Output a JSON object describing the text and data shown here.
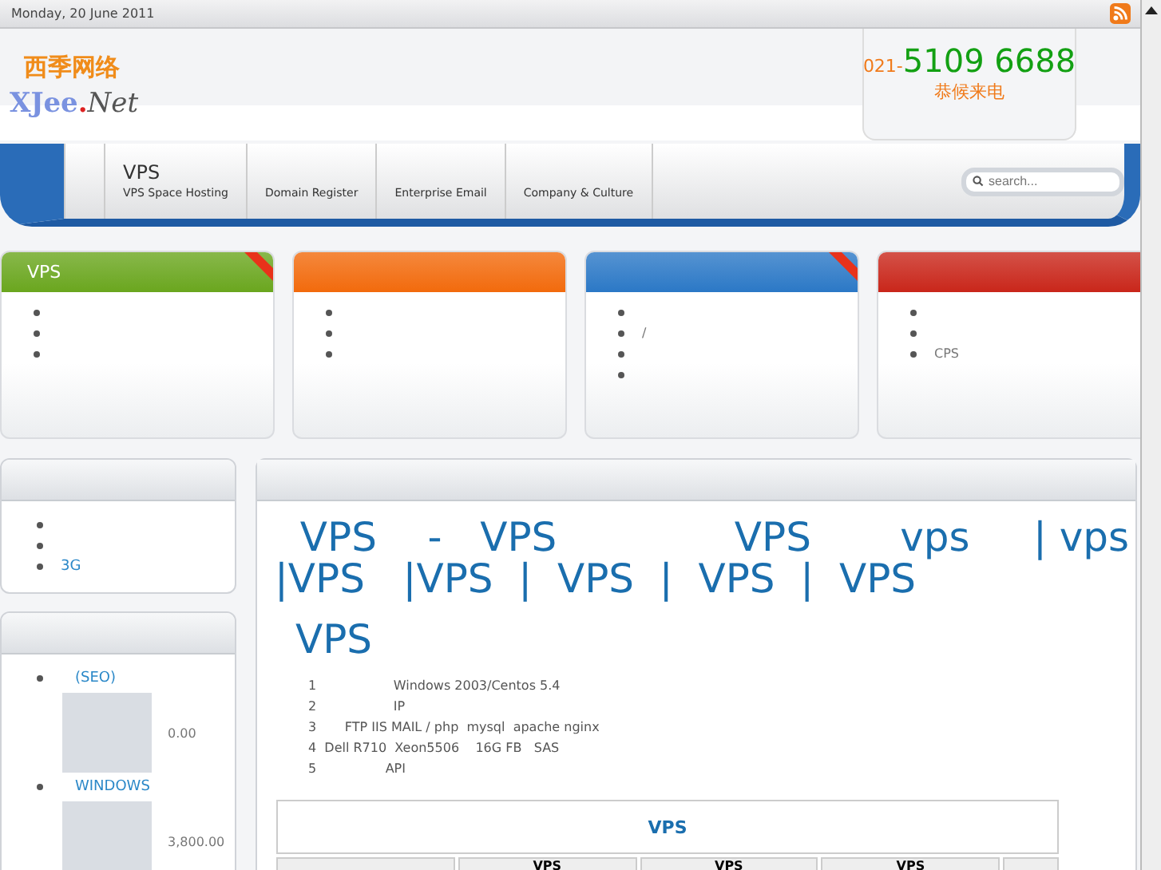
{
  "top_bar": {
    "date": "Monday, 20 June 2011"
  },
  "header": {
    "logo_cn": "西季网络",
    "logo_brand": "XJee",
    "logo_dot": ".",
    "logo_suffix": "Net",
    "phone_prefix": "021-",
    "phone": "5109 6688",
    "phone_note": "恭候来电"
  },
  "nav": {
    "items": [
      {
        "title": "VPS",
        "label": "VPS Space Hosting"
      },
      {
        "label": "Domain Register"
      },
      {
        "label": "Enterprise Email"
      },
      {
        "label": "Company & Culture"
      }
    ],
    "search": {
      "placeholder": "search..."
    }
  },
  "cards": [
    {
      "color": "#6aa61e",
      "title": "VPS",
      "hot": true,
      "items": [
        {
          "kind": "blank"
        },
        {
          "kind": "blank"
        },
        {
          "kind": "blank"
        }
      ]
    },
    {
      "color": "#f26a0c",
      "hot": false,
      "items": [
        {
          "kind": "blank"
        },
        {
          "kind": "blank"
        },
        {
          "kind": "blank"
        }
      ]
    },
    {
      "color": "#2b78c6",
      "hot": true,
      "items": [
        {
          "kind": "blank"
        },
        {
          "kind": "text",
          "text": "/"
        },
        {
          "kind": "blank"
        },
        {
          "kind": "blank"
        }
      ]
    },
    {
      "color": "#c9261a",
      "hot": false,
      "items": [
        {
          "kind": "blank"
        },
        {
          "kind": "blank"
        },
        {
          "kind": "text",
          "text": "CPS"
        }
      ]
    }
  ],
  "sidebar": {
    "links": [
      {
        "kind": "blank"
      },
      {
        "kind": "blank"
      },
      {
        "kind": "text",
        "text": "3G"
      }
    ],
    "products": [
      {
        "name": "(SEO)",
        "price": "0.00"
      },
      {
        "name": "WINDOWS",
        "price": "3,800.00"
      }
    ]
  },
  "main": {
    "headline": "  VPS    -   VPS              VPS       vps     | vps\n|VPS   |VPS  |  VPS  |  VPS  |  VPS",
    "subheading": "VPS",
    "features": [
      "1                   Windows 2003/Centos 5.4",
      "2                   IP",
      "3       FTP IIS MAIL / php  mysql  apache nginx",
      "4  Dell R710  Xeon5506    16G FB   SAS",
      "5                 API"
    ],
    "table": {
      "title": "VPS",
      "columns": [
        "",
        "VPS",
        "VPS",
        "VPS",
        ""
      ]
    }
  }
}
